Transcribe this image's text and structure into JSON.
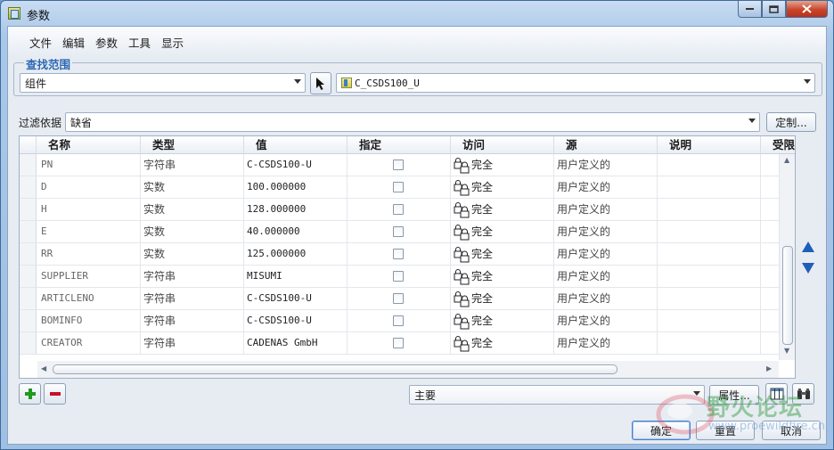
{
  "window": {
    "title": "参数"
  },
  "menu": [
    "文件",
    "编辑",
    "参数",
    "工具",
    "显示"
  ],
  "lookin": {
    "group_label": "查找范围",
    "type_value": "组件",
    "object_value": "C_CSDS100_U"
  },
  "filter": {
    "label": "过滤依据",
    "value": "缺省",
    "customize_label": "定制..."
  },
  "table": {
    "columns": [
      "名称",
      "类型",
      "值",
      "指定",
      "访问",
      "源",
      "说明",
      "受限"
    ],
    "rows": [
      {
        "name": "PN",
        "type": "字符串",
        "value": "C-CSDS100-U",
        "access": "完全",
        "source": "用户定义的"
      },
      {
        "name": "D",
        "type": "实数",
        "value": "100.000000",
        "access": "完全",
        "source": "用户定义的"
      },
      {
        "name": "H",
        "type": "实数",
        "value": "128.000000",
        "access": "完全",
        "source": "用户定义的"
      },
      {
        "name": "E",
        "type": "实数",
        "value": "40.000000",
        "access": "完全",
        "source": "用户定义的"
      },
      {
        "name": "RR",
        "type": "实数",
        "value": "125.000000",
        "access": "完全",
        "source": "用户定义的"
      },
      {
        "name": "SUPPLIER",
        "type": "字符串",
        "value": "MISUMI",
        "access": "完全",
        "source": "用户定义的"
      },
      {
        "name": "ARTICLENO",
        "type": "字符串",
        "value": "C-CSDS100-U",
        "access": "完全",
        "source": "用户定义的"
      },
      {
        "name": "BOMINFO",
        "type": "字符串",
        "value": "C-CSDS100-U",
        "access": "完全",
        "source": "用户定义的"
      },
      {
        "name": "CREATOR",
        "type": "字符串",
        "value": "CADENAS GmbH",
        "access": "完全",
        "source": "用户定义的"
      }
    ]
  },
  "bottom": {
    "set_value": "主要",
    "properties_label": "属性...",
    "ok_label": "确定",
    "reset_label": "重置",
    "cancel_label": "取消"
  },
  "colors": {
    "accent": "#2d67b5",
    "add": "#1f9a1f",
    "remove": "#c8102e",
    "nav_arrow": "#1f5fb8"
  },
  "watermark": {
    "text": "野火论坛",
    "url": "www.proewildfire.cn"
  }
}
